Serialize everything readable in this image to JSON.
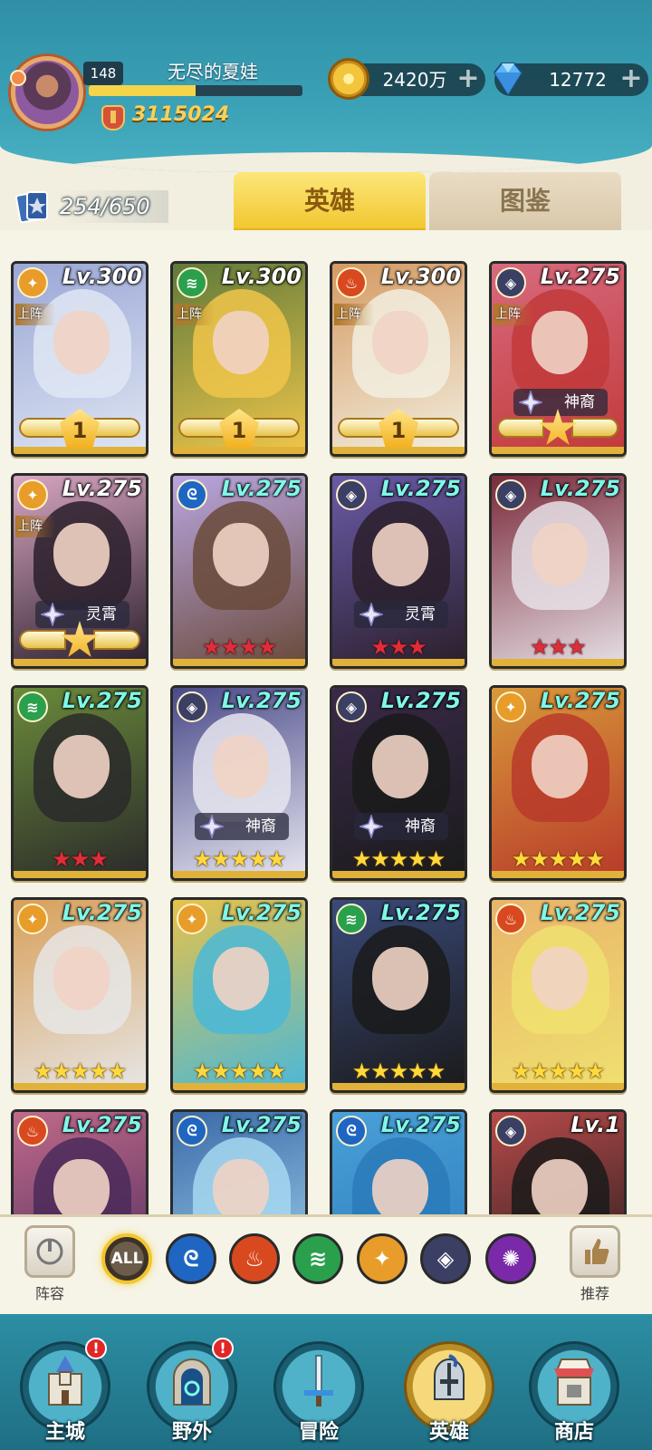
{
  "colors": {
    "header_teal": "#3aa1b6",
    "tab_active": "#f2c62e",
    "element_light": "#e89c2a",
    "element_nature": "#2aa04c",
    "element_fire": "#d8491f",
    "element_dark": "#3b3f63",
    "element_water": "#1f66c2",
    "element_arcane": "#7a2aa8"
  },
  "player": {
    "level": "148",
    "name": "无尽的夏娃",
    "exp_fraction": 0.5,
    "power": "3115024"
  },
  "resources": {
    "gold": "2420万",
    "gems": "12772",
    "gold_icon": "gold-coin-icon",
    "gem_icon": "diamond-icon"
  },
  "collection": {
    "count": "254/650"
  },
  "tabs": {
    "heroes": "英雄",
    "codex": "图鉴"
  },
  "labels": {
    "deployed": "上阵"
  },
  "heroes": [
    {
      "element": "light",
      "level": "Lv.300",
      "deployed": true,
      "badge": null,
      "bottom": "wings-1"
    },
    {
      "element": "nature",
      "level": "Lv.300",
      "deployed": true,
      "badge": null,
      "bottom": "wings-1"
    },
    {
      "element": "fire",
      "level": "Lv.300",
      "deployed": true,
      "badge": null,
      "bottom": "wings-1"
    },
    {
      "element": "dark",
      "level": "Lv.275",
      "deployed": true,
      "badge": "神裔",
      "bottom": "wings-star"
    },
    {
      "element": "light",
      "level": "Lv.275",
      "deployed": true,
      "badge": "灵霄",
      "bottom": "wings-star"
    },
    {
      "element": "water",
      "level": "Lv.275",
      "deployed": false,
      "badge": null,
      "bottom": "red-4"
    },
    {
      "element": "dark",
      "level": "Lv.275",
      "deployed": false,
      "badge": "灵霄",
      "bottom": "red-3"
    },
    {
      "element": "dark",
      "level": "Lv.275",
      "deployed": false,
      "badge": null,
      "bottom": "red-3"
    },
    {
      "element": "nature",
      "level": "Lv.275",
      "deployed": false,
      "badge": null,
      "bottom": "red-3"
    },
    {
      "element": "dark",
      "level": "Lv.275",
      "deployed": false,
      "badge": "神裔",
      "bottom": "gold-5"
    },
    {
      "element": "dark",
      "level": "Lv.275",
      "deployed": false,
      "badge": "神裔",
      "bottom": "gold-5"
    },
    {
      "element": "light",
      "level": "Lv.275",
      "deployed": false,
      "badge": null,
      "bottom": "gold-5"
    },
    {
      "element": "light",
      "level": "Lv.275",
      "deployed": false,
      "badge": null,
      "bottom": "gold-5"
    },
    {
      "element": "light",
      "level": "Lv.275",
      "deployed": false,
      "badge": null,
      "bottom": "gold-5"
    },
    {
      "element": "nature",
      "level": "Lv.275",
      "deployed": false,
      "badge": null,
      "bottom": "gold-5"
    },
    {
      "element": "fire",
      "level": "Lv.275",
      "deployed": false,
      "badge": null,
      "bottom": "gold-5"
    },
    {
      "element": "fire",
      "level": "Lv.275",
      "deployed": false,
      "badge": null,
      "bottom": null
    },
    {
      "element": "water",
      "level": "Lv.275",
      "deployed": false,
      "badge": null,
      "bottom": null
    },
    {
      "element": "water",
      "level": "Lv.275",
      "deployed": false,
      "badge": null,
      "bottom": null
    },
    {
      "element": "dark",
      "level": "Lv.1",
      "deployed": false,
      "badge": null,
      "bottom": null
    }
  ],
  "filters": {
    "lineup_label": "阵容",
    "recommend_label": "推荐",
    "all_label": "ALL",
    "elements": [
      "water",
      "fire",
      "nature",
      "light",
      "dark",
      "arcane"
    ]
  },
  "nav": [
    {
      "id": "main-city",
      "label": "主城",
      "alert": "!"
    },
    {
      "id": "wild",
      "label": "野外",
      "alert": "!"
    },
    {
      "id": "adventure",
      "label": "冒险",
      "alert": null
    },
    {
      "id": "heroes",
      "label": "英雄",
      "alert": null,
      "active": true
    },
    {
      "id": "shop",
      "label": "商店",
      "alert": null
    }
  ]
}
